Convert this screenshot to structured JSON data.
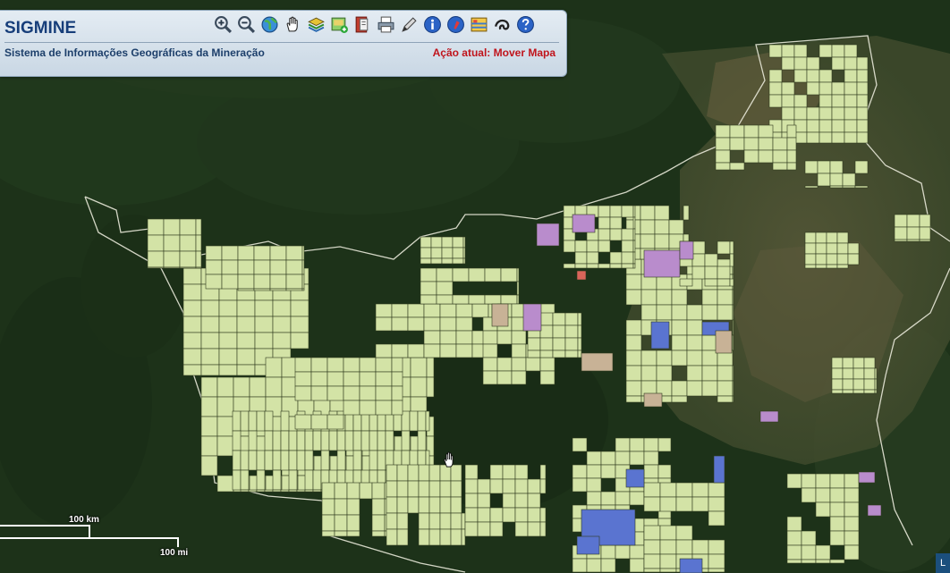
{
  "header": {
    "title": "SIGMINE",
    "subtitle": "Sistema de Informações Geográficas da Mineração",
    "action_status": "Ação atual: Mover Mapa"
  },
  "toolbar": [
    {
      "name": "zoom-in-icon"
    },
    {
      "name": "zoom-out-icon"
    },
    {
      "name": "globe-icon"
    },
    {
      "name": "pan-hand-icon"
    },
    {
      "name": "layers-icon"
    },
    {
      "name": "add-layer-icon"
    },
    {
      "name": "bookmark-icon"
    },
    {
      "name": "print-icon"
    },
    {
      "name": "draw-pencil-icon"
    },
    {
      "name": "info-icon"
    },
    {
      "name": "pin-icon"
    },
    {
      "name": "basemap-icon"
    },
    {
      "name": "fingerprint-icon"
    },
    {
      "name": "help-icon"
    }
  ],
  "scale": {
    "km_label": "100 km",
    "mi_label": "100 mi"
  },
  "corner_tab": "L",
  "colors": {
    "forest": "#1c3219",
    "savanna": "#4a5a36",
    "claim_green": "#d3e3a6",
    "claim_blue": "#5a74d0",
    "claim_purple": "#b98ccc",
    "claim_tan": "#c8b296",
    "claim_red": "#d9655a",
    "claim_outline": "#2f3a1e",
    "brand_title": "#173e7a",
    "action_red": "#c0141c"
  }
}
